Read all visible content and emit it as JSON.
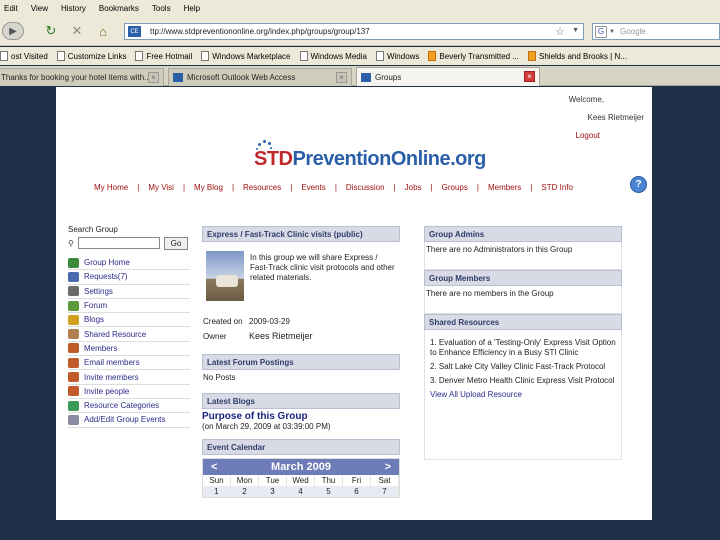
{
  "browser": {
    "menu": [
      "Edit",
      "View",
      "History",
      "Bookmarks",
      "Tools",
      "Help"
    ],
    "url": "ttp://www.stdpreventiononline.org/index.php/groups/group/137",
    "search_placeholder": "Google",
    "bookmarks": [
      {
        "label": "ost Visited",
        "icon": "page-icon"
      },
      {
        "label": "Customize Links",
        "icon": "page-icon"
      },
      {
        "label": "Free Hotmail",
        "icon": "page-icon"
      },
      {
        "label": "Windows Marketplace",
        "icon": "page-icon"
      },
      {
        "label": "Windows Media",
        "icon": "page-icon"
      },
      {
        "label": "Windows",
        "icon": "page-icon"
      },
      {
        "label": "Beverly Transmitted ...",
        "icon": "rss-icon"
      },
      {
        "label": "Shields and Brooks | N...",
        "icon": "rss-icon"
      }
    ],
    "tabs": [
      {
        "label": "Thanks for booking your hotel items with...",
        "active": false
      },
      {
        "label": "Microsoft Outlook Web Access",
        "active": false
      },
      {
        "label": "Groups",
        "active": true
      }
    ]
  },
  "header": {
    "welcome": "Welcome,",
    "user": "Kees Rietmeijer",
    "logout": "Logout",
    "logo_prefix": "STD",
    "logo_rest": "PreventionOnline.org"
  },
  "nav": [
    "My Home",
    "My Visi",
    "My Blog",
    "Resources",
    "Events",
    "Discussion",
    "Jobs",
    "Groups",
    "Members",
    "STD Info"
  ],
  "sidebar": {
    "title": "Search Group",
    "go": "Go",
    "items": [
      {
        "label": "Group Home",
        "color": "#3a8a3a"
      },
      {
        "label": "Requests(7)",
        "color": "#4a6ab0"
      },
      {
        "label": "Settings",
        "color": "#6a6a6a"
      },
      {
        "label": "Forum",
        "color": "#5a9a3a"
      },
      {
        "label": "Blogs",
        "color": "#d0a020"
      },
      {
        "label": "Shared Resource",
        "color": "#b08050"
      },
      {
        "label": "Members",
        "color": "#c05a2a"
      },
      {
        "label": "Email members",
        "color": "#c05a2a"
      },
      {
        "label": "Invite members",
        "color": "#c05a2a"
      },
      {
        "label": "Invite people",
        "color": "#c05a2a"
      },
      {
        "label": "Resource Categories",
        "color": "#3a9a5a"
      },
      {
        "label": "Add/Edit Group Events",
        "color": "#8a8aa0"
      }
    ]
  },
  "group": {
    "title": "Express / Fast-Track Clinic visits (public)",
    "intro": "In this group we will share Express / Fast-Track clinic visit protocols and other related materials.",
    "created_label": "Created on",
    "created_value": "2009-03-29",
    "owner_label": "Owner",
    "owner_value": "Kees Rietmeijer"
  },
  "forum": {
    "title": "Latest Forum Postings",
    "empty": "No Posts"
  },
  "blogs": {
    "title": "Latest Blogs",
    "post_title": "Purpose of this Group",
    "post_date": "(on March 29, 2009 at 03:39:00 PM)"
  },
  "calendar": {
    "title": "Event Calendar",
    "month": "March 2009",
    "prev": "<",
    "next": ">",
    "days": [
      "Sun",
      "Mon",
      "Tue",
      "Wed",
      "Thu",
      "Fri",
      "Sat"
    ],
    "first_week": [
      "1",
      "2",
      "3",
      "4",
      "5",
      "6",
      "7"
    ]
  },
  "admins": {
    "title": "Group Admins",
    "text": "There are no Administrators in this Group"
  },
  "members": {
    "title": "Group Members",
    "text": "There are no members in the Group"
  },
  "resources": {
    "title": "Shared Resources",
    "items": [
      "1. Evaluation of a 'Testing-Only' Express Visit Option to Enhance Efficiency in a Busy STI Clinic",
      "2. Salt Lake City Valley Clinic Fast-Track Protocol",
      "3. Denver Metro Health Clinic Express Visit Protocol"
    ],
    "view_all": "View All Upload Resource"
  }
}
